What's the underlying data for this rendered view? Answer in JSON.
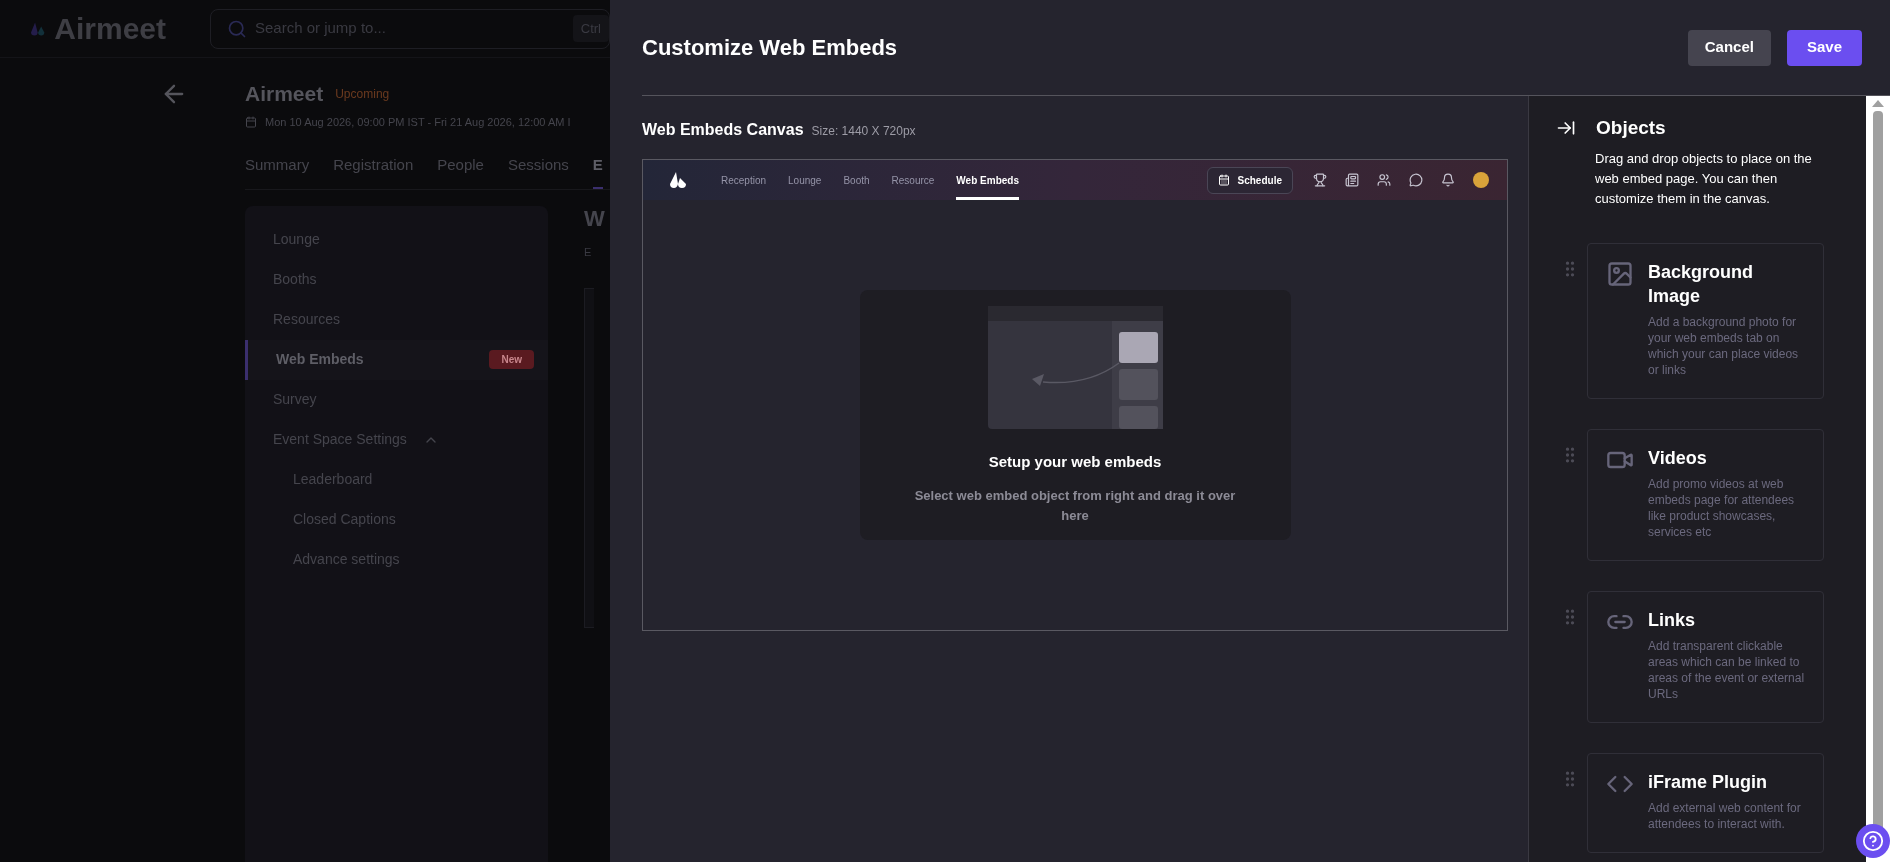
{
  "background_page": {
    "logo": "Airmeet",
    "search": {
      "placeholder": "Search or jump to...",
      "shortcut": "Ctrl"
    },
    "event": {
      "title": "Airmeet",
      "status": "Upcoming",
      "dates": "Mon 10 Aug 2026, 09:00 PM IST - Fri 21 Aug 2026, 12:00 AM I"
    },
    "tabs": [
      {
        "label": "Summary",
        "selected": false
      },
      {
        "label": "Registration",
        "selected": false
      },
      {
        "label": "People",
        "selected": false
      },
      {
        "label": "Sessions",
        "selected": false
      },
      {
        "label": "E",
        "selected": true
      }
    ],
    "sidebar": {
      "items": [
        {
          "label": "Lounge",
          "selected": false
        },
        {
          "label": "Booths",
          "selected": false
        },
        {
          "label": "Resources",
          "selected": false
        },
        {
          "label": "Web Embeds",
          "selected": true,
          "badge": "New"
        },
        {
          "label": "Survey",
          "selected": false
        },
        {
          "label": "Event Space Settings",
          "selected": false,
          "expanded": true,
          "children": [
            {
              "label": "Leaderboard",
              "selected": false
            },
            {
              "label": "Closed Captions",
              "selected": false
            },
            {
              "label": "Advance settings",
              "selected": false
            }
          ]
        }
      ]
    },
    "content_fragments": [
      "W",
      "E"
    ]
  },
  "modal": {
    "title": "Customize Web Embeds",
    "buttons": [
      {
        "label": "Cancel",
        "kind": "secondary"
      },
      {
        "label": "Save",
        "kind": "primary"
      }
    ],
    "canvas": {
      "title": "Web Embeds Canvas",
      "size": "Size: 1440 X 720px",
      "preview_nav": {
        "tabs": [
          {
            "label": "Reception",
            "selected": false
          },
          {
            "label": "Lounge",
            "selected": false
          },
          {
            "label": "Booth",
            "selected": false
          },
          {
            "label": "Resource",
            "selected": false
          },
          {
            "label": "Web Embeds",
            "selected": true
          }
        ],
        "schedule": "Schedule"
      },
      "empty_state": {
        "title": "Setup your web embeds",
        "text": "Select web embed object from right and drag it over here"
      }
    },
    "objects_panel": {
      "title": "Objects",
      "description": "Drag and drop objects to place on the web embed page. You can then customize them in the canvas.",
      "items": [
        {
          "kind": "image",
          "title": "Background Image",
          "description": "Add a background photo for your web embeds tab on which your can place videos or links"
        },
        {
          "kind": "video",
          "title": "Videos",
          "description": "Add promo videos at web embeds page for attendees like product showcases, services etc"
        },
        {
          "kind": "link",
          "title": "Links",
          "description": "Add transparent clickable areas which can be linked to areas of the event or external URLs"
        },
        {
          "kind": "code",
          "title": "iFrame Plugin",
          "description": "Add external web content for attendees to interact with."
        }
      ]
    }
  }
}
